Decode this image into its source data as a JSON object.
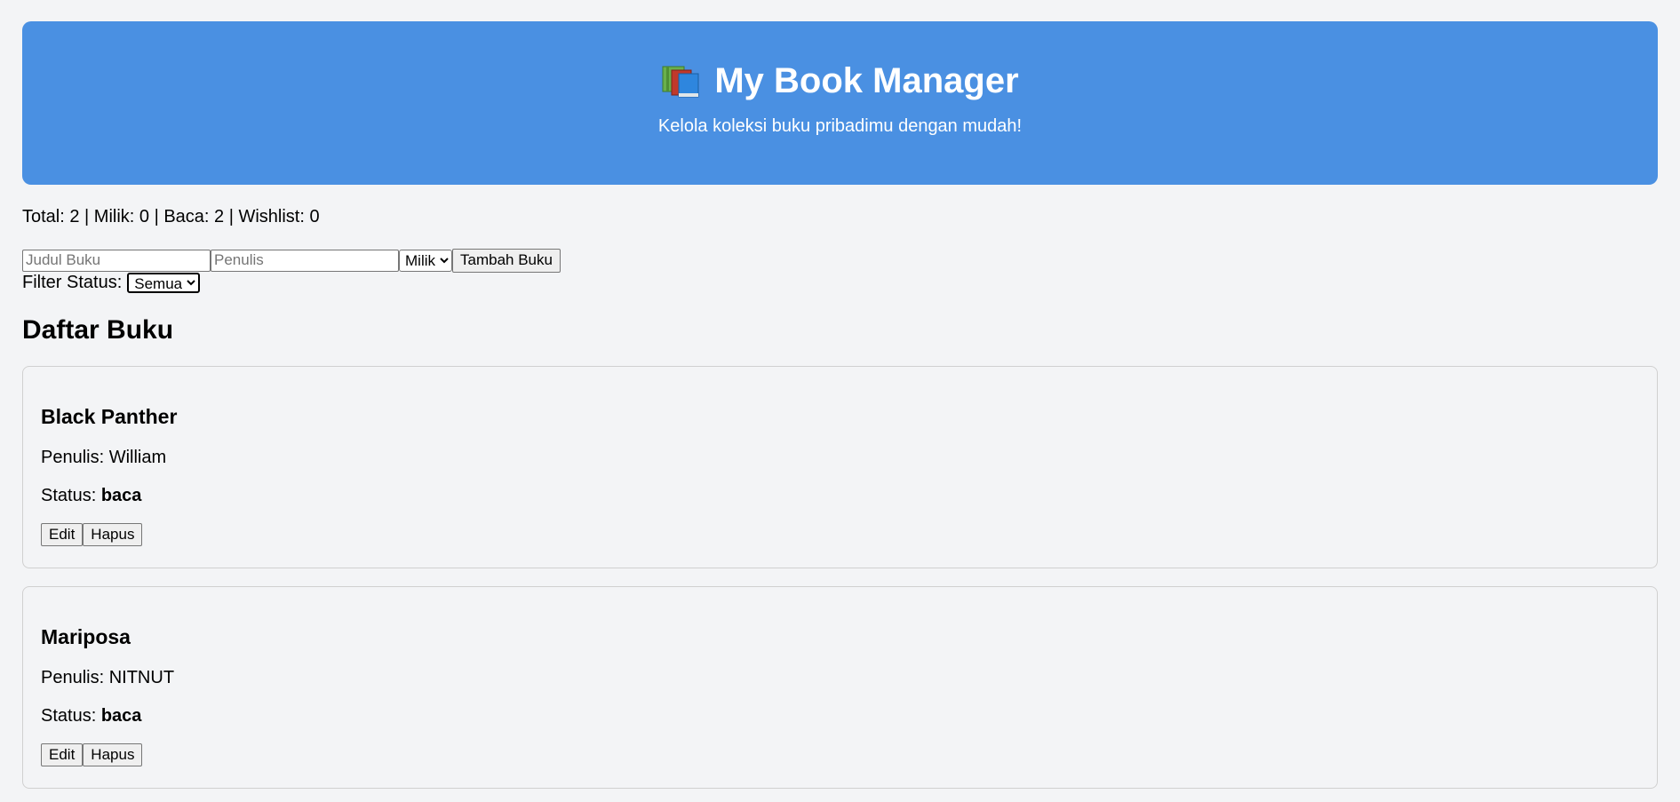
{
  "header": {
    "title": "My Book Manager",
    "subtitle": "Kelola koleksi buku pribadimu dengan mudah!",
    "icon": "books-icon",
    "background_color": "#4a90e2"
  },
  "stats": {
    "text": "Total: 2 | Milik: 0 | Baca: 2 | Wishlist: 0"
  },
  "form": {
    "title_placeholder": "Judul Buku",
    "author_placeholder": "Penulis",
    "status_selected": "Milik",
    "add_button_label": "Tambah Buku"
  },
  "filter": {
    "label": "Filter Status:",
    "selected": "Semua"
  },
  "list": {
    "title": "Daftar Buku",
    "books": [
      {
        "title": "Black Panther",
        "author_label": "Penulis: William",
        "status_label": "Status: ",
        "status_value": "baca",
        "edit_label": "Edit",
        "delete_label": "Hapus"
      },
      {
        "title": "Mariposa",
        "author_label": "Penulis: NITNUT",
        "status_label": "Status: ",
        "status_value": "baca",
        "edit_label": "Edit",
        "delete_label": "Hapus"
      }
    ]
  }
}
